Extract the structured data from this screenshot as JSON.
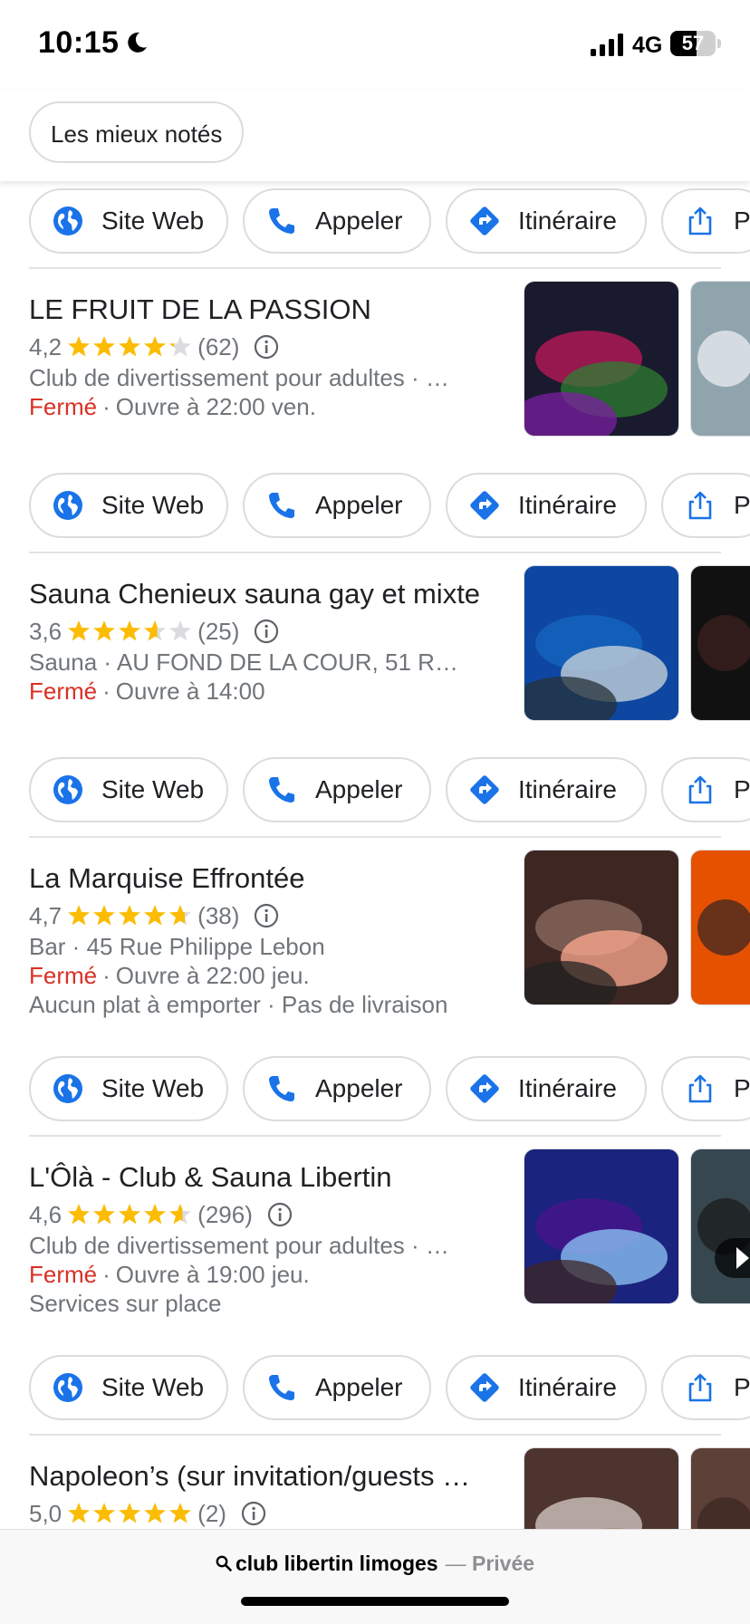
{
  "status_bar": {
    "time": "10:15",
    "network": "4G",
    "battery": "57",
    "battery_level": 0.57
  },
  "filter_chip": {
    "label": "Les mieux notés"
  },
  "actions": {
    "website": "Site Web",
    "call": "Appeler",
    "directions": "Itinéraire",
    "share": "Partager"
  },
  "colors": {
    "star": "#fbbc04",
    "action_blue": "#1a73e8",
    "closed_red": "#d93025"
  },
  "listings": [
    {
      "name": "LE FRUIT DE LA PASSION",
      "rating": "4,2",
      "stars": 4.2,
      "reviews": "(62)",
      "line1": "Club de divertissement pour adultes · …",
      "status": "Fermé",
      "hours": "Ouvre à 22:00 ven.",
      "line3": ""
    },
    {
      "name": "Sauna Chenieux sauna gay et mixte",
      "rating": "3,6",
      "stars": 3.6,
      "reviews": "(25)",
      "line1": "Sauna · AU FOND DE LA COUR, 51 R…",
      "status": "Fermé",
      "hours": "Ouvre à 14:00",
      "line3": ""
    },
    {
      "name": "La Marquise Effrontée",
      "rating": "4,7",
      "stars": 4.7,
      "reviews": "(38)",
      "line1": "Bar · 45 Rue Philippe Lebon",
      "status": "Fermé",
      "hours": "Ouvre à 22:00 jeu.",
      "line3": "Aucun plat à emporter · Pas de livraison"
    },
    {
      "name": "L'Ôlà - Club & Sauna Libertin",
      "rating": "4,6",
      "stars": 4.6,
      "reviews": "(296)",
      "line1": "Club de divertissement pour adultes · …",
      "status": "Fermé",
      "hours": "Ouvre à 19:00 jeu.",
      "line3": "Services sur place"
    },
    {
      "name": "Napoleon’s (sur invitation/guests …",
      "rating": "5,0",
      "stars": 5.0,
      "reviews": "(2)",
      "line1": "",
      "status": "",
      "hours": "",
      "line3": ""
    }
  ],
  "search_bar": {
    "query": "club libertin limoges",
    "separator": "—",
    "mode": "Privée"
  }
}
